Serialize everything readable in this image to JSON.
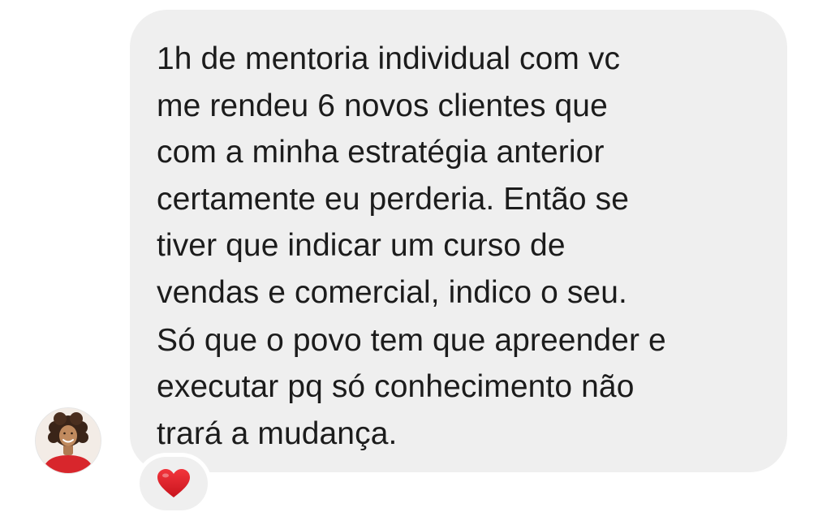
{
  "message": {
    "lines": [
      "1h de mentoria individual com vc",
      "me rendeu 6 novos clientes que",
      "com a minha estratégia anterior",
      "certamente eu perderia. Então se",
      "tiver que indicar um curso de",
      "vendas e comercial, indico o seu.",
      "Só que o povo tem que apreender e",
      "executar pq só conhecimento não",
      "trará a mudança."
    ]
  },
  "sender": {
    "avatar_icon": "profile-photo-icon"
  },
  "reaction": {
    "icon": "heart-icon",
    "color": "#e8202a"
  },
  "colors": {
    "bubble": "#efefef",
    "text": "#1c1c1c",
    "background": "#ffffff"
  }
}
